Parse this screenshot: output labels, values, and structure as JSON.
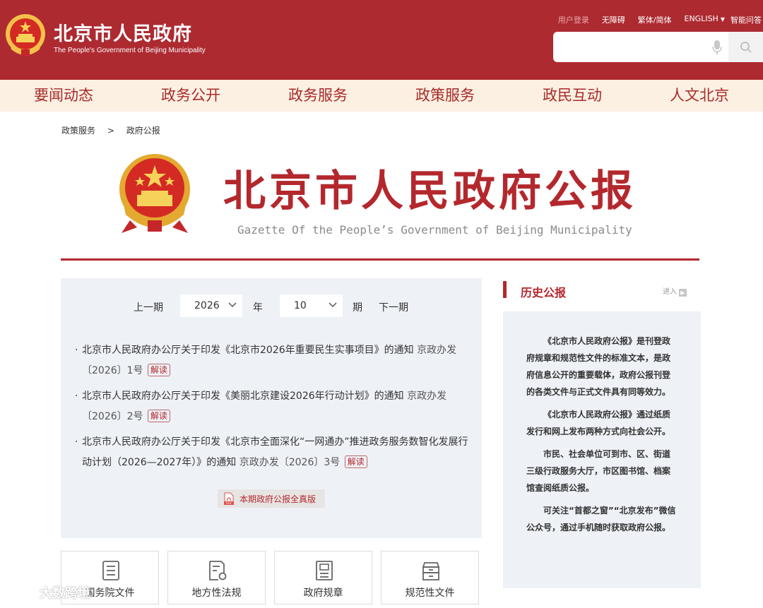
{
  "header": {
    "site_title": "北京市人民政府",
    "site_subtitle": "The People's Government of Beijing Municipality",
    "top_links": {
      "login": "用户登录",
      "accessibility": "无障碍",
      "traditional_simplified": "繁体/简体",
      "english": "ENGLISH",
      "qa": "智能问答"
    },
    "search": {
      "placeholder": ""
    }
  },
  "nav": {
    "items": [
      "要闻动态",
      "政务公开",
      "政务服务",
      "政策服务",
      "政民互动",
      "人文北京"
    ]
  },
  "breadcrumb": {
    "level1": "政策服务",
    "separator": ">",
    "level2": "政府公报"
  },
  "gazette": {
    "title": "北京市人民政府公报",
    "subtitle": "Gazette Of the People’s Government of Beijing Municipality"
  },
  "issue_selector": {
    "prev_label": "上一期",
    "year_value": "2026",
    "year_label": "年",
    "issue_value": "10",
    "issue_label": "期",
    "next_label": "下一期"
  },
  "documents": [
    {
      "title": "北京市人民政府办公厅关于印发《北京市2026年重要民生实事项目》的通知",
      "doc_no": "京政办发〔2026〕1号",
      "badge": "解读"
    },
    {
      "title": "北京市人民政府办公厅关于印发《美丽北京建设2026年行动计划》的通知",
      "doc_no": "京政办发〔2026〕2号",
      "badge": "解读"
    },
    {
      "title": "北京市人民政府办公厅关于印发《北京市全面深化“一网通办”推进政务服务数智化发展行动计划（2026—2027年）》的通知",
      "doc_no": "京政办发〔2026〕3号",
      "badge": "解读"
    }
  ],
  "pdf_button": {
    "label": "本期政府公报全真版",
    "icon_text": "PDF"
  },
  "categories": [
    "国务院文件",
    "地方性法规",
    "政府规章",
    "规范性文件"
  ],
  "sidebar": {
    "title": "历史公报",
    "more": "进入",
    "paragraphs": [
      "《北京市人民政府公报》是刊登政府规章和规范性文件的标准文本，是政府信息公开的重要载体，政府公报刊登的各类文件与正式文件具有同等效力。",
      "《北京市人民政府公报》通过纸质发行和网上发布两种方式向社会公开。",
      "市民、社会单位可到市、区、街道三级行政服务大厅，市区图书馆、档案馆查阅纸质公报。",
      "可关注“首都之窗”“北京发布”微信公众号，通过手机随时获取政府公报。"
    ]
  },
  "watermark": {
    "text": "大数跨境"
  },
  "colors": {
    "brand_red": "#ad2a31",
    "nav_bg": "#fbf0e2",
    "panel_bg": "#eef1f6"
  }
}
